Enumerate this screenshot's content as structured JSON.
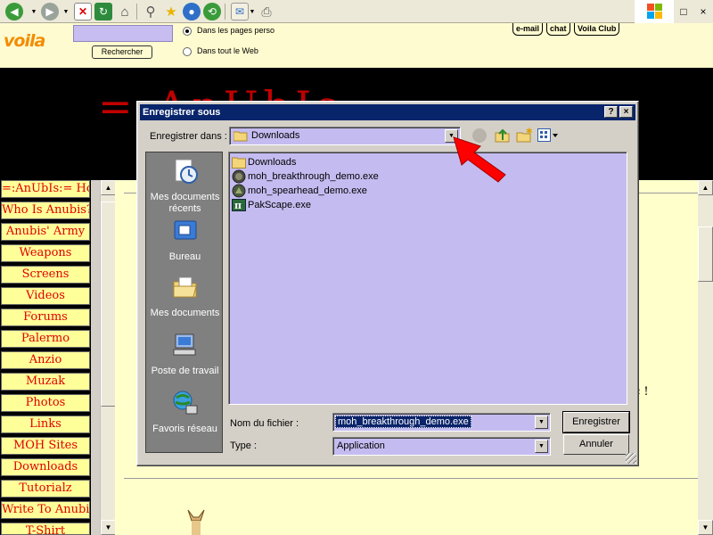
{
  "browser": {
    "toolbar_icons": [
      "back-icon",
      "forward-icon",
      "stop-icon",
      "refresh-icon",
      "home-icon",
      "search-icon",
      "favorites-icon",
      "media-icon",
      "history-icon",
      "mail-icon",
      "print-icon"
    ],
    "window_controls": [
      "□",
      "×"
    ]
  },
  "voila_bar": {
    "logo": "voila",
    "search_value": "",
    "search_button": "Rechercher",
    "radio_pages_perso": "Dans les pages perso",
    "radio_web": "Dans tout le Web",
    "tabs": [
      "e-mail",
      "chat",
      "Voila Club"
    ]
  },
  "page": {
    "title": "=:AnUbIs:=",
    "side_text": "c !",
    "nav": [
      "=:AnUbIs:= Home",
      "Who Is Anubis?",
      "Anubis' Army",
      "Weapons",
      "Screens",
      "Videos",
      "Forums",
      "Palermo",
      "Anzio",
      "Muzak",
      "Photos",
      "Links",
      "MOH Sites",
      "Downloads",
      "Tutorialz",
      "Write To Anubis",
      "T-Shirt"
    ]
  },
  "dialog": {
    "title": "Enregistrer sous",
    "help_button": "?",
    "close_button": "×",
    "save_in_label": "Enregistrer dans :",
    "save_in_value": "Downloads",
    "places": [
      {
        "label": "Mes documents récents",
        "icon": "recent-documents-icon"
      },
      {
        "label": "Bureau",
        "icon": "desktop-icon"
      },
      {
        "label": "Mes documents",
        "icon": "my-documents-icon"
      },
      {
        "label": "Poste de travail",
        "icon": "my-computer-icon"
      },
      {
        "label": "Favoris réseau",
        "icon": "network-places-icon"
      }
    ],
    "files": [
      {
        "name": "Downloads",
        "icon": "folder-icon"
      },
      {
        "name": "moh_breakthrough_demo.exe",
        "icon": "moh-app-icon"
      },
      {
        "name": "moh_spearhead_demo.exe",
        "icon": "moh-app-icon"
      },
      {
        "name": "PakScape.exe",
        "icon": "pakscape-icon"
      }
    ],
    "filename_label": "Nom du fichier :",
    "filename_value": "moh_breakthrough_demo.exe",
    "type_label": "Type :",
    "type_value": "Application",
    "save_button": "Enregistrer",
    "cancel_button": "Annuler"
  },
  "colors": {
    "dialog_title_bar": "#08246b",
    "file_list_bg": "#c4bcf0",
    "nav_bg": "#ffff99",
    "nav_text": "#e00000",
    "annotation_arrow": "#ff0000"
  }
}
